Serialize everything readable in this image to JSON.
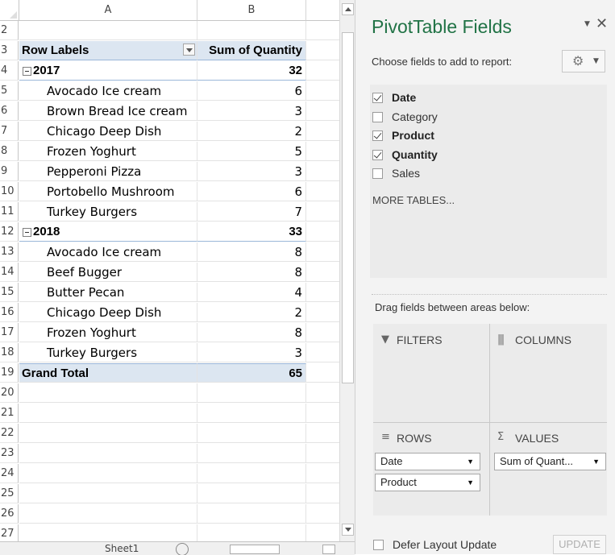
{
  "sheet": {
    "columns": [
      "A",
      "B"
    ],
    "header": {
      "rownum": "3",
      "label": "Row Labels",
      "value": "Sum of Quantity"
    },
    "row2": "2",
    "groups": [
      {
        "rownum": "4",
        "year": "2017",
        "total": "32",
        "items": [
          {
            "rownum": "5",
            "name": "Avocado Ice cream",
            "qty": "6"
          },
          {
            "rownum": "6",
            "name": "Brown Bread Ice cream",
            "qty": "3"
          },
          {
            "rownum": "7",
            "name": "Chicago Deep Dish",
            "qty": "2"
          },
          {
            "rownum": "8",
            "name": "Frozen Yoghurt",
            "qty": "5"
          },
          {
            "rownum": "9",
            "name": "Pepperoni Pizza",
            "qty": "3"
          },
          {
            "rownum": "10",
            "name": "Portobello Mushroom",
            "qty": "6"
          },
          {
            "rownum": "11",
            "name": "Turkey Burgers",
            "qty": "7"
          }
        ]
      },
      {
        "rownum": "12",
        "year": "2018",
        "total": "33",
        "items": [
          {
            "rownum": "13",
            "name": "Avocado Ice cream",
            "qty": "8"
          },
          {
            "rownum": "14",
            "name": "Beef Bugger",
            "qty": "8"
          },
          {
            "rownum": "15",
            "name": "Butter Pecan",
            "qty": "4"
          },
          {
            "rownum": "16",
            "name": "Chicago Deep Dish",
            "qty": "2"
          },
          {
            "rownum": "17",
            "name": "Frozen Yoghurt",
            "qty": "8"
          },
          {
            "rownum": "18",
            "name": "Turkey Burgers",
            "qty": "3"
          }
        ]
      }
    ],
    "grand_total": {
      "rownum": "19",
      "label": "Grand Total",
      "value": "65"
    },
    "empty_rows": [
      "20",
      "21",
      "22",
      "23",
      "24",
      "25",
      "26",
      "27"
    ],
    "sheet_tab": "Sheet1"
  },
  "panel": {
    "title": "PivotTable Fields",
    "choose_label": "Choose fields to add to report:",
    "fields": [
      {
        "label": "Date",
        "checked": true
      },
      {
        "label": "Category",
        "checked": false
      },
      {
        "label": "Product",
        "checked": true
      },
      {
        "label": "Quantity",
        "checked": true
      },
      {
        "label": "Sales",
        "checked": false
      }
    ],
    "more_tables": "MORE TABLES...",
    "drag_label": "Drag fields between areas below:",
    "areas": {
      "filters": "FILTERS",
      "columns": "COLUMNS",
      "rows": "ROWS",
      "values": "VALUES"
    },
    "row_fields": [
      "Date",
      "Product"
    ],
    "value_fields": [
      "Sum of Quant..."
    ],
    "defer_label": "Defer Layout Update",
    "update_label": "UPDATE"
  },
  "colors": {
    "accent": "#217346",
    "pivot_header": "#dce6f1"
  }
}
